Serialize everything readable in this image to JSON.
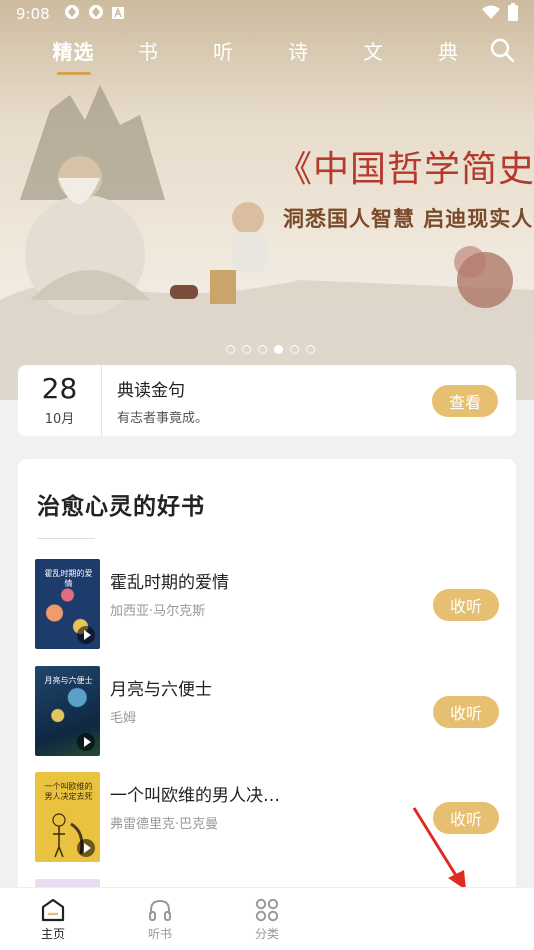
{
  "status": {
    "time": "9:08"
  },
  "nav": {
    "tabs": [
      "精选",
      "书",
      "听",
      "诗",
      "文",
      "典"
    ],
    "active_index": 0
  },
  "banner": {
    "title": "《中国哲学简史》",
    "subtitle": "洞悉国人智慧 启迪现实人生",
    "dot_count": 6,
    "active_dot": 3
  },
  "daily_quote": {
    "day": "28",
    "month": "10月",
    "title": "典读金句",
    "text": "有志者事竟成。",
    "button": "查看"
  },
  "book_list": {
    "title": "治愈心灵的好书",
    "items": [
      {
        "title": "霍乱时期的爱情",
        "author": "加西亚·马尔克斯",
        "button": "收听",
        "cover_text": "霍乱时期的爱情"
      },
      {
        "title": "月亮与六便士",
        "author": "毛姆",
        "button": "收听",
        "cover_text": "月亮与六便士"
      },
      {
        "title": "一个叫欧维的男人决…",
        "author": "弗雷德里克·巴克曼",
        "button": "收听",
        "cover_text": "一个叫欧维的男人决定去死"
      }
    ]
  },
  "bottom_nav": {
    "items": [
      "主页",
      "听书",
      "分类"
    ],
    "active_index": 0
  },
  "colors": {
    "accent_gold": "#e6bf71",
    "tab_underline": "#d4a351",
    "banner_title": "#b53a2d",
    "annotation_arrow": "#e02a22"
  }
}
